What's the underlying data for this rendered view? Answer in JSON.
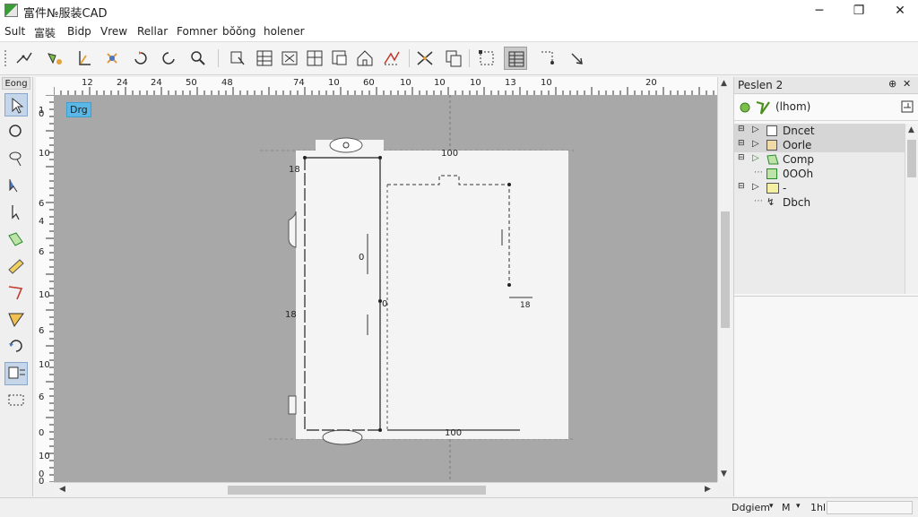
{
  "window": {
    "title": "富件№服装CAD",
    "minimize": "─",
    "maximize": "❐",
    "close": "✕"
  },
  "menu": [
    "Sult",
    "富裝",
    "Bidp",
    "Vrew",
    "Rellar",
    "Fomner",
    "bŏŏng",
    "holener"
  ],
  "toolbar": {
    "buttons": [
      "pen-tool-icon",
      "node-edit-icon",
      "measure-icon",
      "star-point-icon",
      "rotate-icon",
      "rotate-back-icon",
      "zoom-icon",
      "select-piece-icon",
      "grid-piece-icon",
      "symmetry-icon",
      "panel-icon",
      "dart-icon",
      "house-icon",
      "seam-icon",
      "cross-line-icon",
      "copy-piece-icon",
      "select-box-icon",
      "layout-icon",
      "corner-icon",
      "arrow-tool-icon"
    ],
    "active_index": 17
  },
  "left_panel": {
    "title": "Eong",
    "tools": [
      "select-arrow-icon",
      "circle-icon",
      "lasso-icon",
      "point-arrow-icon",
      "move-arrow-icon",
      "fill-icon",
      "ruler-icon",
      "bezier-icon",
      "triangle-icon",
      "rotate-tool-icon",
      "snap-icon",
      "frame-icon"
    ],
    "active_indices": [
      0,
      10
    ]
  },
  "ruler_top": [
    "12",
    "24",
    "24",
    "50",
    "48",
    "74",
    "10",
    "60",
    "10",
    "10",
    "10",
    "13",
    "10",
    "20"
  ],
  "ruler_left": [
    "1",
    "0",
    "10",
    "6",
    "4",
    "6",
    "10",
    "6",
    "10",
    "6",
    "0",
    "10",
    "0",
    "0"
  ],
  "canvas": {
    "tag": "Drg",
    "labels": [
      "100",
      "18",
      "0",
      "18",
      "0",
      "18",
      "100"
    ]
  },
  "right_panel": {
    "title": "Peslen 2",
    "pin": "⊕",
    "close": "✕",
    "view_label": "(lhom)",
    "tree": [
      {
        "label": "Dncet",
        "selected": true
      },
      {
        "label": "Oorle",
        "selected": true
      },
      {
        "label": "Comp",
        "selected": false
      },
      {
        "label": "0OOh",
        "selected": false
      },
      {
        "label": "-",
        "selected": false
      },
      {
        "label": "Dbch",
        "selected": false
      }
    ]
  },
  "status": {
    "item1": "Ddgiem",
    "item2": "M",
    "item3": "1hl"
  },
  "colors": {
    "canvas_bg": "#a8a8a8",
    "sheet_bg": "#f4f4f4",
    "accent": "#5bb8e6"
  }
}
